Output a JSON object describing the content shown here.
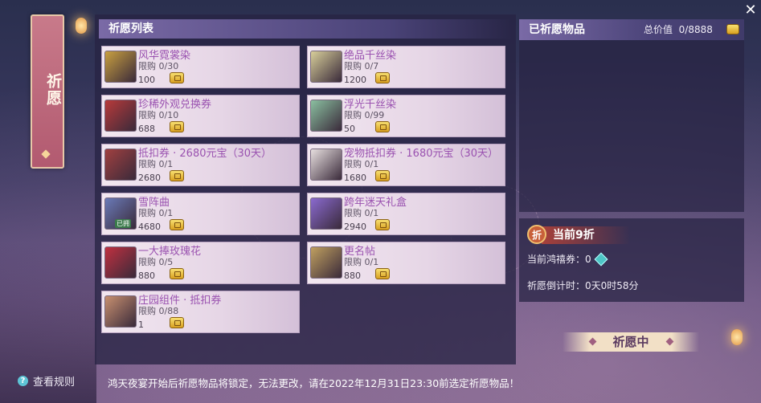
{
  "side_tab": {
    "label": "祈愿"
  },
  "rules": {
    "label": "查看规则"
  },
  "wish_list": {
    "title": "祈愿列表",
    "items": [
      {
        "name": "风华霓裳染",
        "limit": "限购 0/30",
        "price": "100",
        "thumb": "#c9a040"
      },
      {
        "name": "绝品千丝染",
        "limit": "限购 0/7",
        "price": "1200",
        "thumb": "#d8cf9a"
      },
      {
        "name": "珍稀外观兑换券",
        "limit": "限购 0/10",
        "price": "688",
        "thumb": "#b83a3a"
      },
      {
        "name": "浮光千丝染",
        "limit": "限购 0/99",
        "price": "50",
        "thumb": "#8ac0a0"
      },
      {
        "name": "抵扣券 · 2680元宝（30天）",
        "limit": "限购 0/1",
        "price": "2680",
        "thumb": "#a04040"
      },
      {
        "name": "宠物抵扣券 · 1680元宝（30天）",
        "limit": "限购 0/1",
        "price": "1680",
        "thumb": "#e8e0e0"
      },
      {
        "name": "雪阵曲",
        "limit": "限购 0/1",
        "price": "4680",
        "thumb": "#6a7ab8",
        "owned": "已拥"
      },
      {
        "name": "跨年迷天礼盒",
        "limit": "限购 0/1",
        "price": "2940",
        "thumb": "#8a6ad0"
      },
      {
        "name": "一大捧玫瑰花",
        "limit": "限购 0/5",
        "price": "880",
        "thumb": "#c03040"
      },
      {
        "name": "更名帖",
        "limit": "限购 0/1",
        "price": "880",
        "thumb": "#c0a060"
      },
      {
        "name": "庄园组件 · 抵扣券",
        "limit": "限购 0/88",
        "price": "1",
        "thumb": "#c89070"
      }
    ]
  },
  "wished": {
    "title": "已祈愿物品",
    "total_label": "总价值",
    "total_value": "0/8888"
  },
  "discount": {
    "chip": "折",
    "label": "当前9折",
    "coupon": "当前鸿禧券：0",
    "countdown": "祈愿倒计时：0天0时58分"
  },
  "status": {
    "label": "祈愿中"
  },
  "notice": "鸿天夜宴开始后祈愿物品将锁定，无法更改，请在2022年12月31日23:30前选定祈愿物品！",
  "close": "✕"
}
